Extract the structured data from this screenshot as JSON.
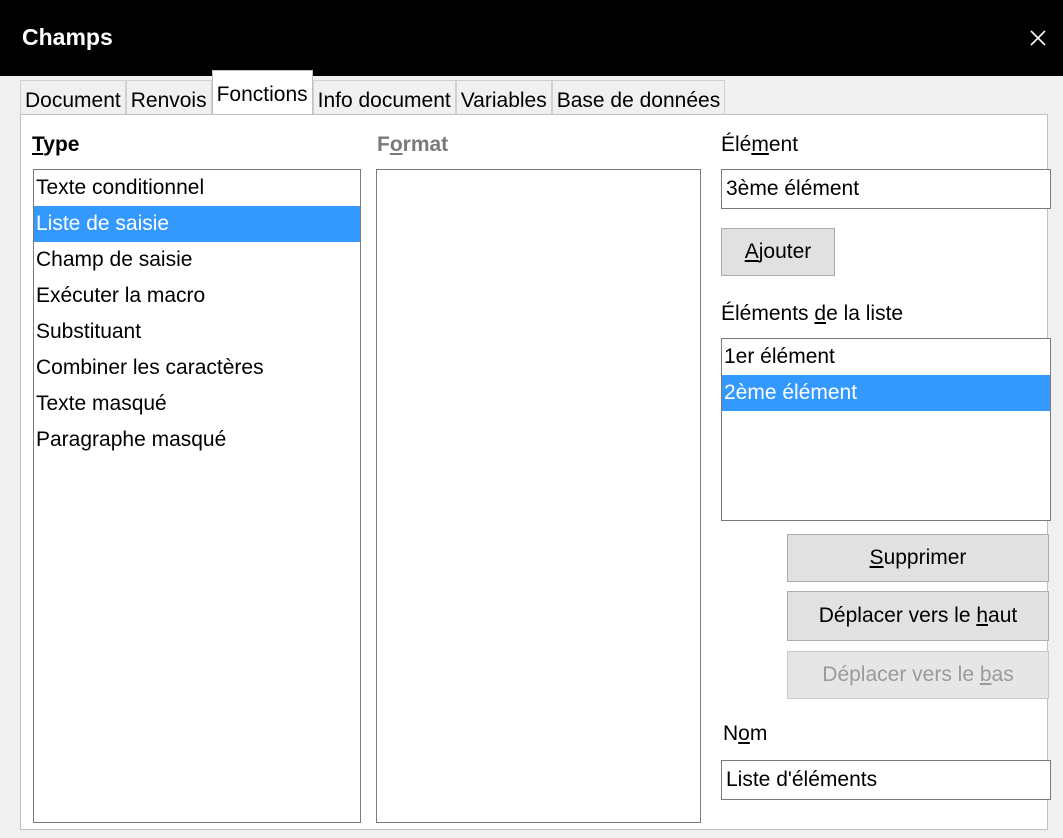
{
  "window": {
    "title": "Champs",
    "close_symbol": "×"
  },
  "tabs": [
    {
      "label": "Document"
    },
    {
      "label": "Renvois"
    },
    {
      "label": "Fonctions",
      "active": true
    },
    {
      "label": "Info document"
    },
    {
      "label": "Variables"
    },
    {
      "label": "Base de données"
    }
  ],
  "type": {
    "label_mnemonic": "T",
    "label_rest": "ype",
    "items": [
      {
        "label": "Texte conditionnel",
        "selected": false
      },
      {
        "label": "Liste de saisie",
        "selected": true
      },
      {
        "label": "Champ de saisie",
        "selected": false
      },
      {
        "label": "Exécuter la macro",
        "selected": false
      },
      {
        "label": "Substituant",
        "selected": false
      },
      {
        "label": "Combiner les caractères",
        "selected": false
      },
      {
        "label": "Texte masqué",
        "selected": false
      },
      {
        "label": "Paragraphe masqué",
        "selected": false
      }
    ]
  },
  "format": {
    "label_pre": "F",
    "label_mnemonic": "o",
    "label_rest": "rmat"
  },
  "element": {
    "label_pre": "Élé",
    "label_mnemonic": "m",
    "label_rest": "ent",
    "value": "3ème élément"
  },
  "add_button": {
    "mnemonic": "A",
    "rest": "jouter"
  },
  "list_items": {
    "label_pre": "Éléments ",
    "label_mnemonic": "d",
    "label_rest": "e la liste",
    "items": [
      {
        "label": "1er élément",
        "selected": false
      },
      {
        "label": "2ème élément",
        "selected": true
      }
    ]
  },
  "remove_button": {
    "mnemonic": "S",
    "rest": "upprimer"
  },
  "move_up_button": {
    "pre": "Déplacer vers le ",
    "mnemonic": "h",
    "rest": "aut"
  },
  "move_down_button": {
    "pre": "Déplacer vers le ",
    "mnemonic": "b",
    "rest": "as",
    "disabled": true
  },
  "name": {
    "label_pre": "N",
    "label_mnemonic": "o",
    "label_rest": "m",
    "value": "Liste d'éléments"
  }
}
